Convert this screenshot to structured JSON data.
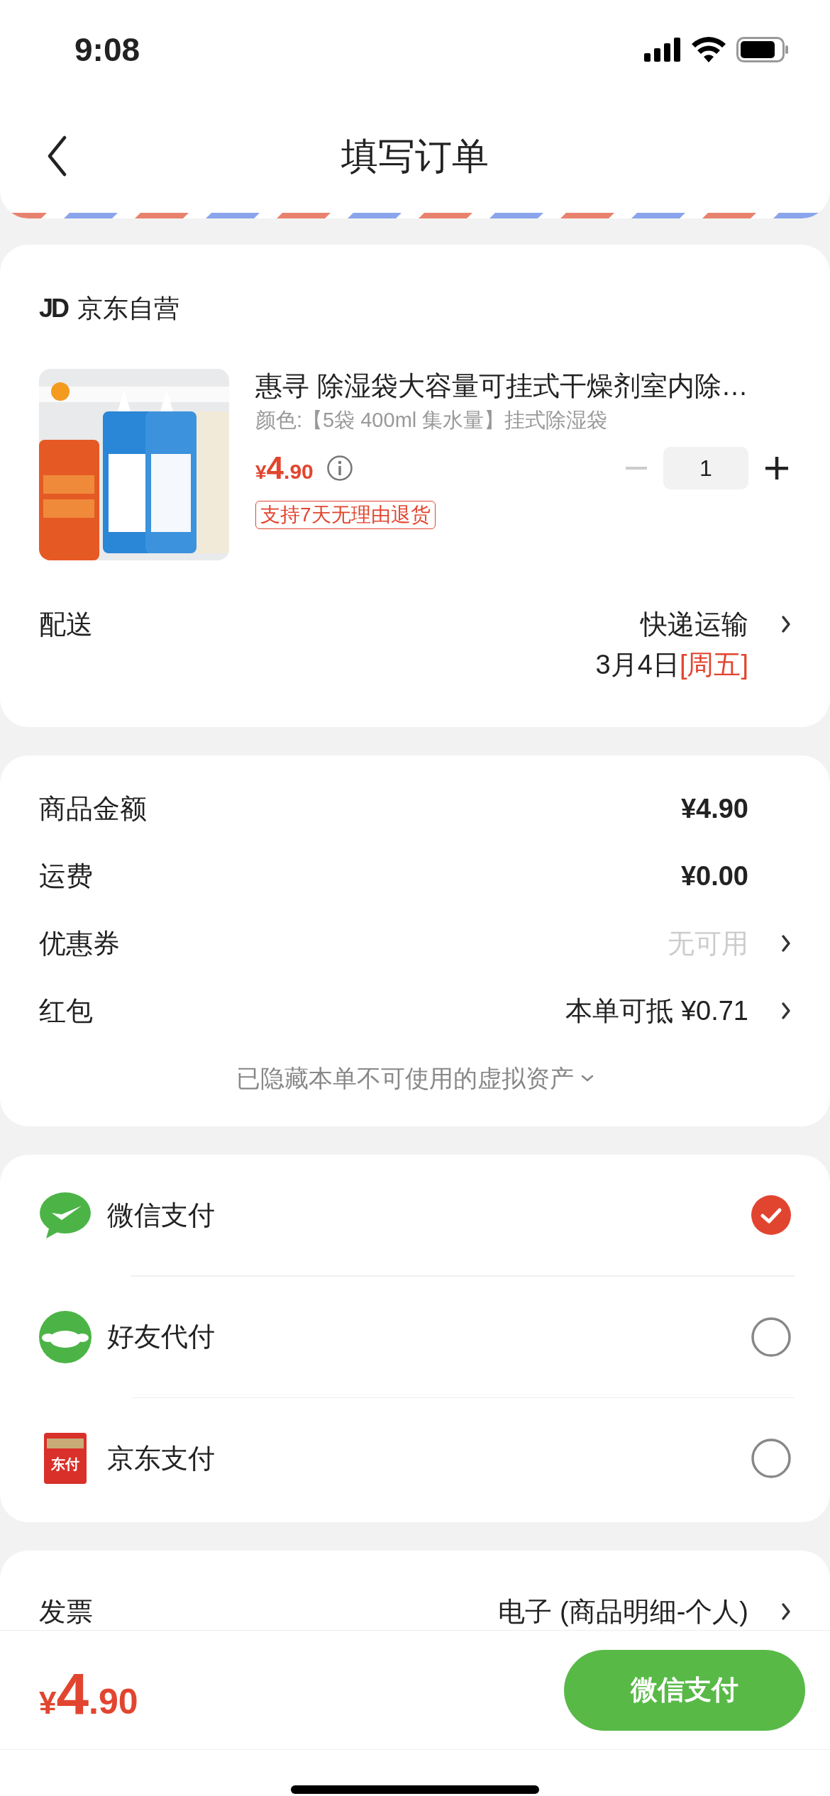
{
  "status_bar": {
    "time": "9:08"
  },
  "nav": {
    "title": "填写订单"
  },
  "store": {
    "logo": "JD",
    "name": "京东自营"
  },
  "product": {
    "title": "惠寻 除湿袋大容量可挂式干燥剂室内除…",
    "spec": "颜色:【5袋 400ml 集水量】挂式除湿袋",
    "price": {
      "symbol": "¥",
      "integer": "4",
      "decimal": ".90"
    },
    "quantity": "1",
    "tag": "支持7天无理由退货"
  },
  "delivery": {
    "label": "配送",
    "method": "快递运输",
    "date": "3月4日",
    "weekday": "[周五]"
  },
  "fees": [
    {
      "label": "商品金额",
      "value": "¥4.90",
      "kind": "amount",
      "arrow": false
    },
    {
      "label": "运费",
      "value": "¥0.00",
      "kind": "amount",
      "arrow": false
    },
    {
      "label": "优惠券",
      "value": "无可用",
      "kind": "muted",
      "arrow": true
    },
    {
      "label": "红包",
      "value": "本单可抵 ¥0.71",
      "kind": "text",
      "arrow": true
    }
  ],
  "hidden_note": "已隐藏本单不可使用的虚拟资产",
  "payments": [
    {
      "name": "微信支付",
      "kind": "wechat",
      "selected": true
    },
    {
      "name": "好友代付",
      "kind": "friend",
      "selected": false
    },
    {
      "name": "京东支付",
      "kind": "jdpay",
      "selected": false,
      "icon_text": "东付"
    }
  ],
  "invoice": {
    "label": "发票",
    "value": "电子 (商品明细-个人)"
  },
  "bottom_bar": {
    "price": {
      "symbol": "¥",
      "integer": "4",
      "decimal": ".90"
    },
    "pay_button": "微信支付"
  }
}
